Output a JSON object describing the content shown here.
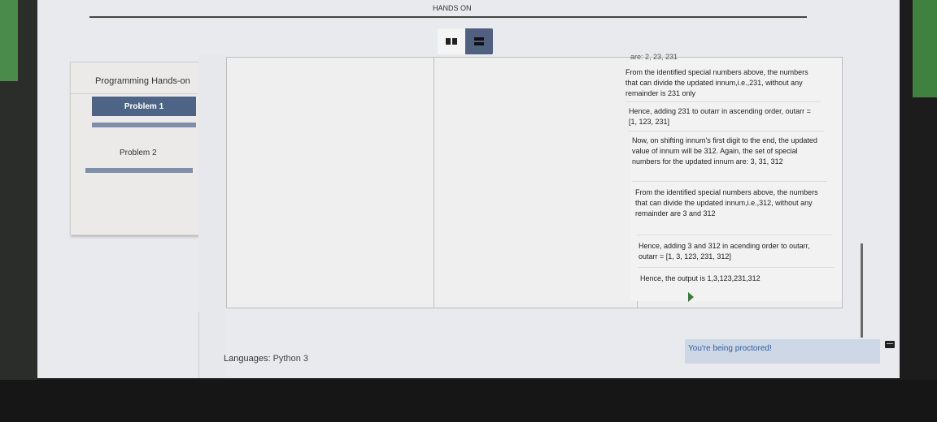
{
  "header": {
    "title": "HANDS ON"
  },
  "sidebar": {
    "title": "Programming Hands-on",
    "problems": [
      {
        "label": "Problem 1",
        "active": true
      },
      {
        "label": "Problem 2",
        "active": false
      }
    ]
  },
  "explanation": {
    "cut_text": "are: 2, 23, 231",
    "paragraphs": [
      "From the identified special numbers above, the numbers that can divide the updated innum,i.e.,231, without any remainder is 231 only",
      "Hence, adding 231 to outarr in ascending order, outarr = [1, 123, 231]",
      "Now, on shifting innum's first digit to the end, the updated value of innum will be 312. Again, the set of special numbers for the updated  innum are: 3, 31, 312",
      "From the identified special numbers above, the numbers that can divide the updated innum,i.e.,312, without any remainder are 3 and 312",
      "Hence, adding 3 and 312 in acending order to outarr, outarr = [1, 3, 123, 231, 312]",
      "Hence, the output is 1,3,123,231,312"
    ]
  },
  "footer": {
    "languages_label": "Languages:",
    "languages_value": "Python 3",
    "proctor_text": "You're being proctored!"
  },
  "icons": {
    "split_view": "split-view-icon",
    "stacked_view": "stacked-view-icon",
    "chat": "chat-icon",
    "cursor": "mouse-cursor-icon"
  },
  "colors": {
    "accent": "#4d6487",
    "proctor_bg": "#cdd7e6",
    "proctor_text": "#3060a0"
  }
}
